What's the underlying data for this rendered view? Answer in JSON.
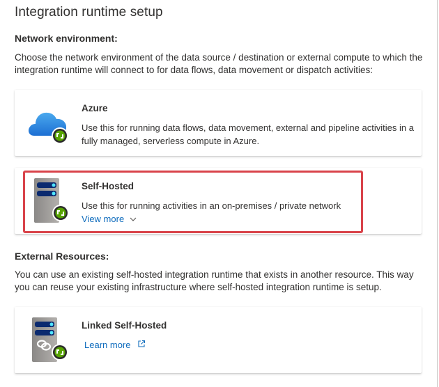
{
  "title": "Integration runtime setup",
  "network": {
    "heading": "Network environment:",
    "description": "Choose the network environment of the data source / destination or external compute to which the integration runtime will connect to for data flows, data movement or dispatch activities:"
  },
  "options": [
    {
      "title": "Azure",
      "description": "Use this for running data flows, data movement, external and pipeline activities in a fully managed, serverless compute in Azure.",
      "icon": "azure-cloud-icon"
    },
    {
      "title": "Self-Hosted",
      "description": "Use this for running activities in an on-premises / private network",
      "link": "View more",
      "selected": true,
      "icon": "server-icon"
    }
  ],
  "external": {
    "heading": "External Resources:",
    "description": "You can use an existing self-hosted integration runtime that exists in another resource. This way you can reuse your existing infrastructure where self-hosted integration runtime is setup.",
    "option": {
      "title": "Linked Self-Hosted",
      "link": "Learn more",
      "icon": "linked-server-icon"
    }
  },
  "colors": {
    "highlight": "#d9434a",
    "link": "#0f6cbd",
    "runtime_badge": "#57a300"
  }
}
